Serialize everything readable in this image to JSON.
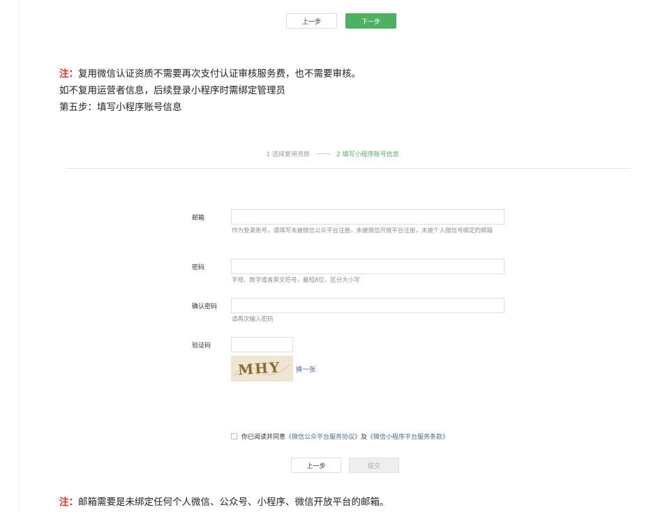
{
  "top_nav": {
    "prev_label": "上一步",
    "next_label": "下一步"
  },
  "notes": {
    "note1_prefix": "注：",
    "note1_text": "复用微信认证资质不需要再次支付认证审核服务费，也不需要审核。",
    "line2": "如不复用运营者信息，后续登录小程序时需绑定管理员",
    "line3": "第五步：填写小程序账号信息",
    "note2_prefix": "注：",
    "note2_text": "邮箱需要是未绑定任何个人微信、公众号、小程序、微信开放平台的邮箱。"
  },
  "steps": [
    {
      "label": "1 选择复用资质",
      "active": false
    },
    {
      "label": "2 填写小程序账号信息",
      "active": true
    }
  ],
  "form": {
    "email": {
      "label": "邮箱",
      "value": "",
      "hint": "作为登录账号，请填写未被微信公众平台注册，未被微信开放平台注册，未被个人微信号绑定的邮箱"
    },
    "password": {
      "label": "密码",
      "value": "",
      "hint": "字母、数字或者英文符号，最短8位，区分大小写"
    },
    "confirm_password": {
      "label": "确认密码",
      "value": "",
      "hint": "请再次输入密码"
    },
    "captcha": {
      "label": "验证码",
      "value": "",
      "image_text": "MHY",
      "refresh_label": "换一张"
    }
  },
  "agreement": {
    "checked": false,
    "prefix": "你已阅读并同意",
    "link1": "《微信公众平台服务协议》",
    "joiner": "及",
    "link2": "《微信小程序平台服务条款》"
  },
  "bottom_nav": {
    "prev_label": "上一步",
    "submit_label": "提交"
  },
  "colors": {
    "primary_green": "#4db161",
    "note_red": "#e32b1f",
    "link_blue": "#4a6897"
  }
}
